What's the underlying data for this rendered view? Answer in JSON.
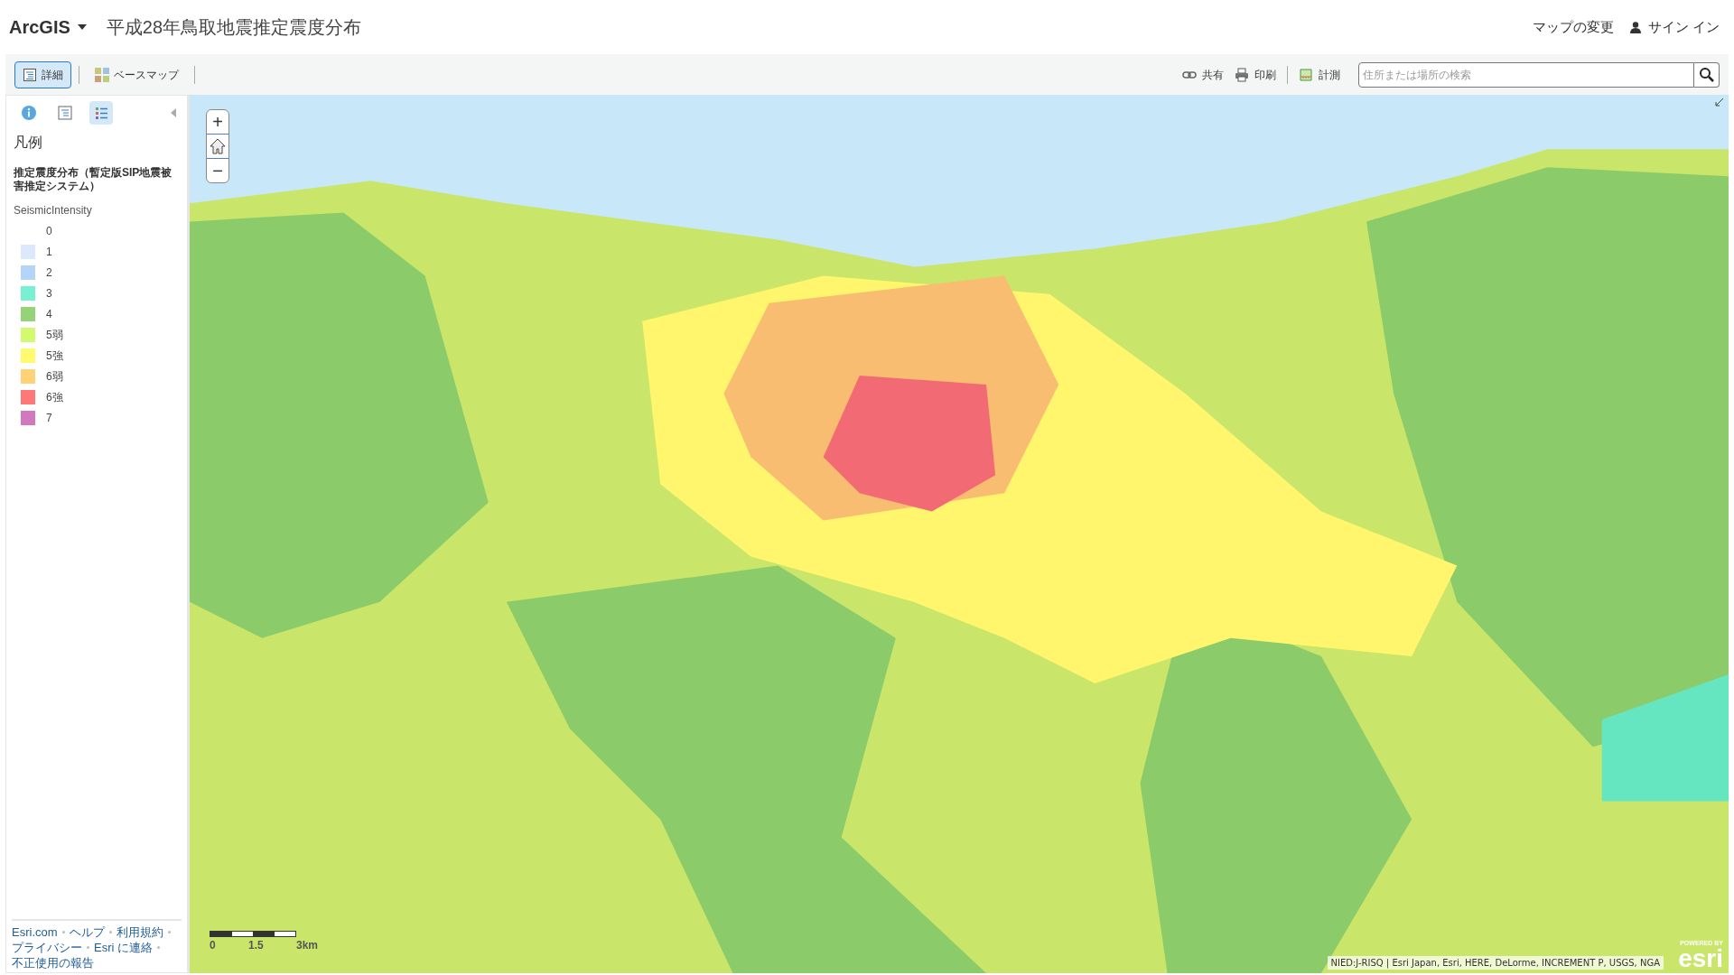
{
  "header": {
    "app_menu": "ArcGIS",
    "title": "平成28年鳥取地震推定震度分布",
    "change_map": "マップの変更",
    "sign_in": "サイン イン"
  },
  "toolbar": {
    "left": [
      {
        "label": "詳細",
        "kind": "details",
        "selected": true
      },
      {
        "label": "ベースマップ",
        "kind": "basemap",
        "selected": false
      }
    ],
    "right": [
      {
        "label": "共有",
        "kind": "share"
      },
      {
        "label": "印刷",
        "kind": "print"
      },
      {
        "label": "計測",
        "kind": "measure"
      }
    ],
    "search": {
      "placeholder": "住所または場所の検索"
    }
  },
  "sidebar": {
    "tabs": [
      {
        "kind": "about",
        "selected": false
      },
      {
        "kind": "content",
        "selected": false
      },
      {
        "kind": "legend",
        "selected": true
      }
    ],
    "heading": "凡例",
    "layer": "推定震度分布（暫定版SIP地震被害推定システム）",
    "field": "SeismicIntensity",
    "legend": [
      {
        "label": "0"
      },
      {
        "label": "1",
        "color": "#dce8fc"
      },
      {
        "label": "2",
        "color": "#b4d4fa"
      },
      {
        "label": "3",
        "color": "#78f0d2"
      },
      {
        "label": "4",
        "color": "#96d278"
      },
      {
        "label": "5弱",
        "color": "#d2fa6e"
      },
      {
        "label": "5強",
        "color": "#fffa6e"
      },
      {
        "label": "6弱",
        "color": "#ffd278"
      },
      {
        "label": "6強",
        "color": "#ff7878"
      },
      {
        "label": "7",
        "color": "#d278be"
      }
    ],
    "footer_links": [
      "Esri.com",
      "ヘルプ",
      "利用規約",
      "プライバシー",
      "Esri に連絡",
      "不正使用の報告"
    ]
  },
  "map": {
    "zoom_in": "+",
    "zoom_out": "−",
    "scale_labels": [
      "0",
      "1.5",
      "3km"
    ],
    "attribution": "NIED:J-RISQ | Esri Japan, Esri, HERE, DeLorme, INCREMENT P, USGS, NGA",
    "logo_caption": "POWERED BY",
    "logo": "esri"
  }
}
